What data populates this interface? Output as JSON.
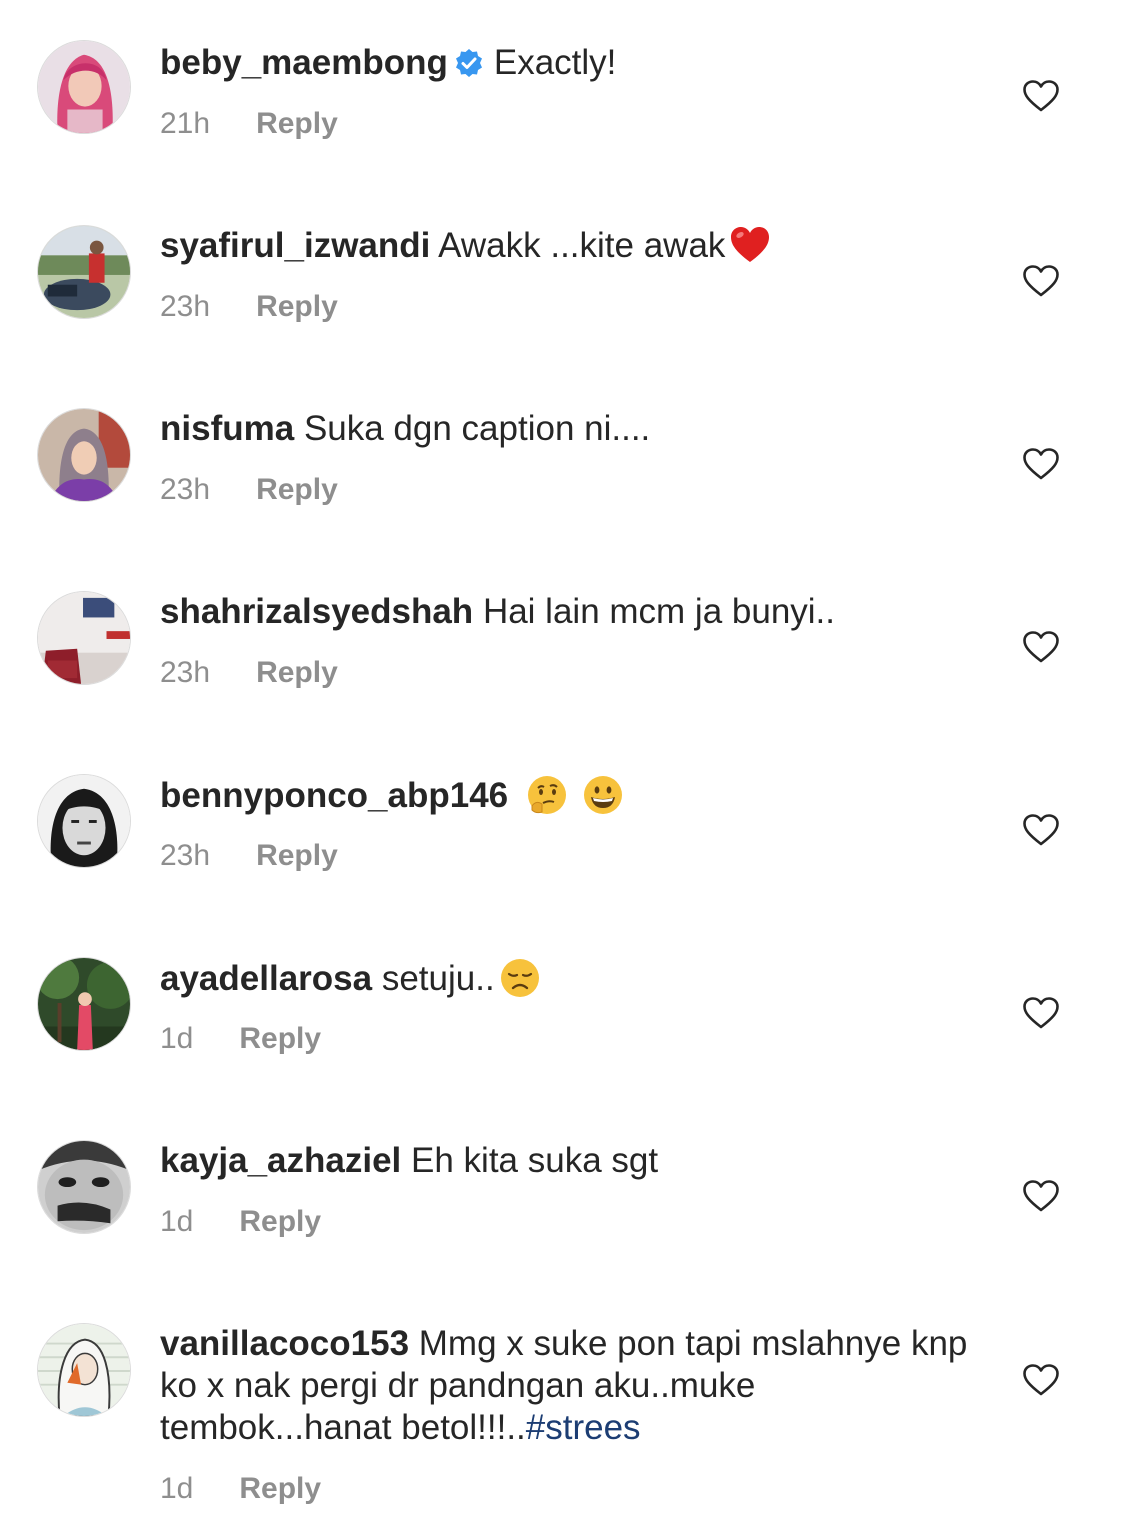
{
  "comments": [
    {
      "username": "beby_maembong",
      "text": "Exactly!",
      "time": "21h",
      "reply": "Reply",
      "verified": true,
      "avatar": "pink-hair-avatar"
    },
    {
      "username": "syafirul_izwandi",
      "text": "Awakk ...kite awak",
      "emoji": "red-heart-emoji",
      "time": "23h",
      "reply": "Reply",
      "avatar": "motorbike-avatar"
    },
    {
      "username": "nisfuma",
      "text": "Suka dgn caption ni....",
      "time": "23h",
      "reply": "Reply",
      "avatar": "hijab-avatar"
    },
    {
      "username": "shahrizalsyedshah",
      "text": "Hai lain mcm ja bunyi..",
      "time": "23h",
      "reply": "Reply",
      "avatar": "room-avatar"
    },
    {
      "username": "bennyponco_abp146",
      "text": "",
      "emoji": "thinking-face-emoji, grinning-face-emoji",
      "time": "23h",
      "reply": "Reply",
      "avatar": "bw-face-avatar"
    },
    {
      "username": "ayadellarosa",
      "text": "setuju..",
      "emoji": "disappointed-face-emoji",
      "time": "1d",
      "reply": "Reply",
      "avatar": "garden-avatar"
    },
    {
      "username": "kayja_azhaziel",
      "text": "Eh kita suka sgt",
      "time": "1d",
      "reply": "Reply",
      "avatar": "bw-eyes-avatar"
    },
    {
      "username": "vanillacoco153",
      "text": "Mmg x suke pon tapi mslahnye knp ko  x nak pergi dr pandngan aku..muke tembok...hanat betol!!!..",
      "hashtag": "#strees",
      "time": "1d",
      "reply": "Reply",
      "avatar": "hijab-drawing-avatar"
    }
  ]
}
